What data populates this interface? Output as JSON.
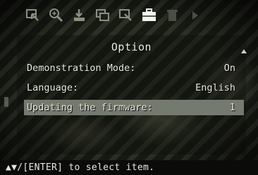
{
  "toolbar": {
    "icons": [
      "select-icon",
      "zoom-icon",
      "transfer-icon",
      "copy-icon",
      "edit-icon",
      "toolbox-icon",
      "trash-icon",
      "arrow-right-icon"
    ]
  },
  "menu": {
    "title": "Option",
    "items": [
      {
        "label": "Demonstration Mode:",
        "value": "On"
      },
      {
        "label": "Language:",
        "value": "English"
      },
      {
        "label": "Updating the firmware:",
        "value": "1",
        "selected": true
      }
    ]
  },
  "hint": "▲▼/[ENTER] to select item.",
  "colors": {
    "selected_row": "#747a6e",
    "text": "#e8e8e2",
    "hint_bar": "#0b0c09"
  }
}
